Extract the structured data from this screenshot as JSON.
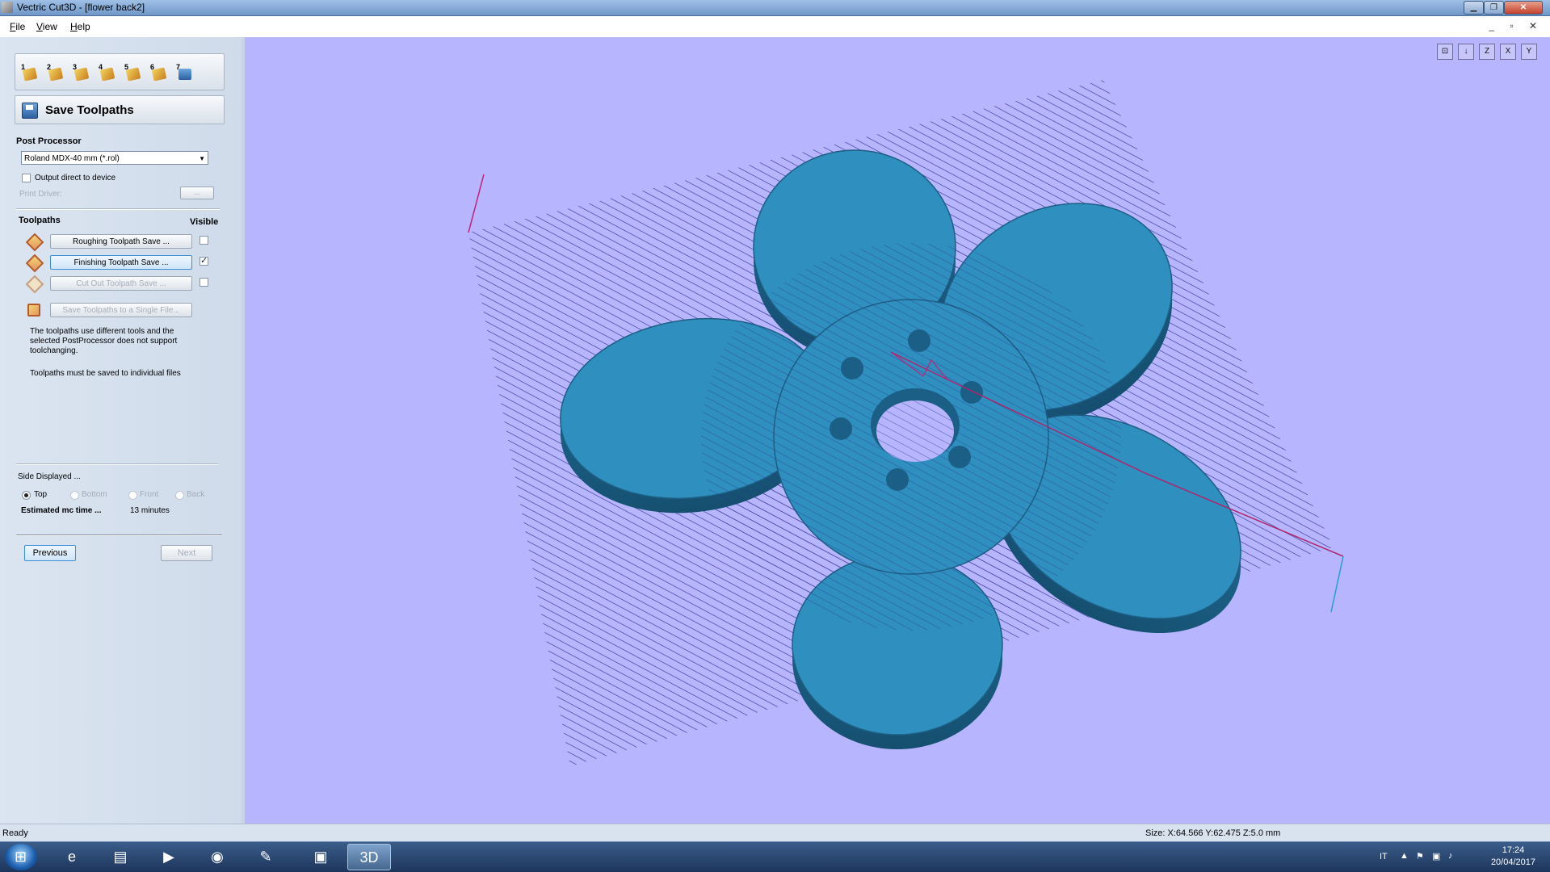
{
  "window": {
    "title": "Vectric Cut3D - [flower back2]",
    "min_glyph": "▁",
    "max_glyph": "❐",
    "close_glyph": "✕"
  },
  "menu": [
    "File",
    "View",
    "Help"
  ],
  "mdi_controls": "_ ▫ ✕",
  "wizard": {
    "steps": [
      "1",
      "2",
      "3",
      "4",
      "5",
      "6",
      "7"
    ],
    "header": "Save Toolpaths"
  },
  "post_processor": {
    "label": "Post Processor",
    "selected": "Roland MDX-40 mm (*.rol)",
    "output_direct_label": "Output direct to device",
    "print_driver_label": "Print Driver:",
    "browse_label": "..."
  },
  "toolpaths": {
    "label": "Toolpaths",
    "visible_label": "Visible",
    "items": [
      {
        "label": "Roughing Toolpath Save ...",
        "visible": false
      },
      {
        "label": "Finishing Toolpath Save ...",
        "visible": true
      },
      {
        "label": "Cut Out Toolpath Save ...",
        "visible": false
      }
    ],
    "single_file_label": "Save Toolpaths to a Single File...",
    "note1": "The toolpaths use different tools and the selected PostProcessor does not support toolchanging.",
    "note2": "Toolpaths must be saved to individual files"
  },
  "side_displayed": {
    "label": "Side Displayed ...",
    "options": [
      "Top",
      "Bottom",
      "Front",
      "Back"
    ],
    "selected": "Top"
  },
  "estimate": {
    "label": "Estimated mc time ...",
    "value": "13 minutes"
  },
  "nav": {
    "previous": "Previous",
    "next": "Next"
  },
  "view_icons": [
    "⊡",
    "↓",
    "Z",
    "X",
    "Y"
  ],
  "status": {
    "ready": "Ready",
    "size": "Size: X:64.566 Y:62.475 Z:5.0 mm"
  },
  "taskbar": {
    "apps": [
      "e",
      "▤",
      "▶",
      "◉",
      "✎",
      "▣",
      "3D"
    ],
    "lang": "IT",
    "time": "17:24",
    "date": "20/04/2017"
  },
  "colors": {
    "viewport_bg": "#b6b5fe",
    "model": "#2f8fbf",
    "toolpath": "#2b2e8f"
  }
}
